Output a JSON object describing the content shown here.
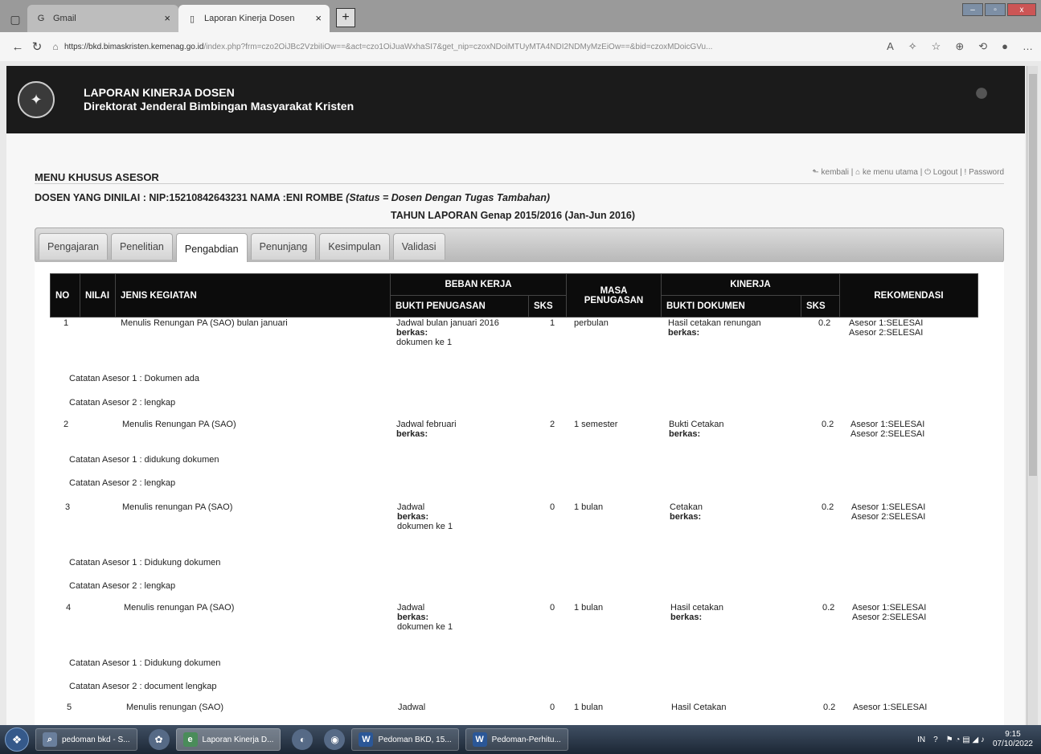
{
  "browser": {
    "tabs": [
      {
        "label": "Gmail",
        "icon": "google-icon",
        "active": false
      },
      {
        "label": "Laporan Kinerja Dosen",
        "icon": "page-icon",
        "active": true
      }
    ],
    "url_host": "https://bkd.bimaskristen.kemenag.go.id",
    "url_rest": "/index.php?frm=czo2OiJBc2VzbiIiOw==&act=czo1OiJuaWxhaSI7&get_nip=czoxNDoiMTUyMTA4NDI2NDMyMzEiOw==&bid=czoxMDoicGVu..."
  },
  "site": {
    "title": "LAPORAN KINERJA DOSEN",
    "subtitle": "Direktorat Jenderal Bimbingan Masyarakat Kristen"
  },
  "page": {
    "menu_title": "MENU KHUSUS ASESOR",
    "links": {
      "back": "kembali",
      "main_menu": "ke menu utama",
      "logout": "Logout",
      "password": "Password"
    },
    "dosen_prefix": "DOSEN YANG DINILAI : NIP:15210842643231   NAMA :ENI ROMBE ",
    "dosen_status": "(Status = Dosen Dengan Tugas Tambahan)",
    "tahun": "TAHUN LAPORAN Genap 2015/2016 (Jan-Jun 2016)",
    "tabs": [
      "Pengajaran",
      "Penelitian",
      "Pengabdian",
      "Penunjang",
      "Kesimpulan",
      "Validasi"
    ],
    "active_tab": "Pengabdian"
  },
  "table": {
    "headers": {
      "no": "NO",
      "nilai": "NILAI",
      "jenis": "JENIS KEGIATAN",
      "beban": "BEBAN KERJA",
      "bukti_penugasan": "BUKTI PENUGASAN",
      "sks": "SKS",
      "masa": "MASA PENUGASAN",
      "kinerja": "KINERJA",
      "bukti_dokumen": "BUKTI DOKUMEN",
      "sks2": "SKS",
      "rekomendasi": "REKOMENDASI"
    },
    "berkas_label": "berkas:",
    "rows": [
      {
        "no": "1",
        "jenis": "Menulis Renungan PA (SAO) bulan januari",
        "bukti_penugasan": "Jadwal bulan januari 2016",
        "file": "dokumen ke 1",
        "sks": "1",
        "masa": "perbulan",
        "bukti_dokumen": "Hasil cetakan renungan",
        "sks2": "0.2",
        "rek1": "Asesor 1:SELESAI",
        "rek2": "Asesor 2:SELESAI",
        "catatan1": "Catatan Asesor 1 : Dokumen ada",
        "catatan2": "Catatan Asesor 2 : lengkap"
      },
      {
        "no": "2",
        "jenis": "Menulis Renungan PA (SAO)",
        "bukti_penugasan": "Jadwal februari",
        "file": "",
        "sks": "2",
        "masa": "1 semester",
        "bukti_dokumen": "Bukti Cetakan",
        "sks2": "0.2",
        "rek1": "Asesor 1:SELESAI",
        "rek2": "Asesor 2:SELESAI",
        "catatan1": "Catatan Asesor 1 : didukung dokumen",
        "catatan2": "Catatan Asesor 2 : lengkap"
      },
      {
        "no": "3",
        "jenis": "Menulis renungan PA (SAO)",
        "bukti_penugasan": "Jadwal",
        "file": "dokumen ke 1",
        "sks": "0",
        "masa": "1 bulan",
        "bukti_dokumen": "Cetakan",
        "sks2": "0.2",
        "rek1": "Asesor 1:SELESAI",
        "rek2": "Asesor 2:SELESAI",
        "catatan1": "Catatan Asesor 1 : Didukung dokumen",
        "catatan2": "Catatan Asesor 2 : lengkap"
      },
      {
        "no": "4",
        "jenis": "Menulis renungan PA (SAO)",
        "bukti_penugasan": "Jadwal",
        "file": "dokumen ke 1",
        "sks": "0",
        "masa": "1 bulan",
        "bukti_dokumen": "Hasil cetakan",
        "sks2": "0.2",
        "rek1": "Asesor 1:SELESAI",
        "rek2": "Asesor 2:SELESAI",
        "catatan1": "Catatan Asesor 1 : Didukung dokumen",
        "catatan2": "Catatan Asesor 2 : document lengkap"
      },
      {
        "no": "5",
        "jenis": "Menulis renungan (SAO)",
        "bukti_penugasan": "Jadwal",
        "sks": "0",
        "masa": "1 bulan",
        "bukti_dokumen": "Hasil Cetakan",
        "sks2": "0.2",
        "rek1": "Asesor 1:SELESAI"
      }
    ]
  },
  "taskbar": {
    "items": [
      {
        "label": "pedoman bkd - S...",
        "icon": "search-icon"
      },
      {
        "label": "Laporan Kinerja D...",
        "icon": "browser-icon",
        "active": true
      },
      {
        "label": "Pedoman BKD, 15...",
        "icon": "word-icon"
      },
      {
        "label": "Pedoman-Perhitu...",
        "icon": "word-icon"
      }
    ],
    "lang": "IN",
    "time": "9:15",
    "date": "07/10/2022"
  }
}
